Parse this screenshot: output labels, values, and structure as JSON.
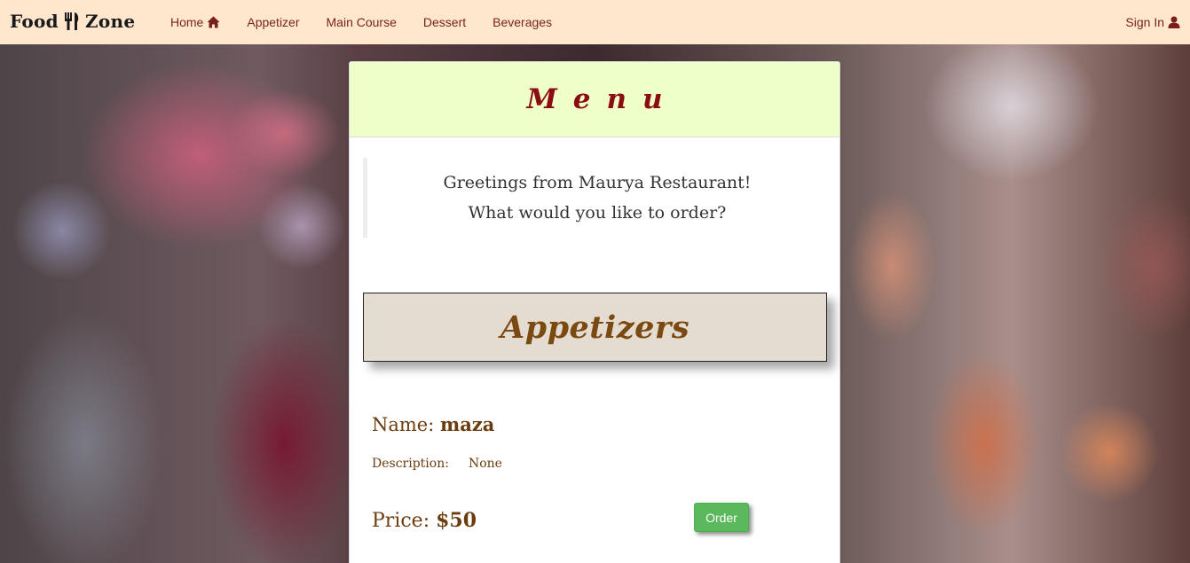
{
  "navbar": {
    "brand_left": "Food",
    "brand_right": "Zone",
    "brand_icon": "fork-knife-icon",
    "links": [
      {
        "label": "Home",
        "icon": "home-icon"
      },
      {
        "label": "Appetizer"
      },
      {
        "label": "Main Course"
      },
      {
        "label": "Dessert"
      },
      {
        "label": "Beverages"
      }
    ],
    "sign_in": {
      "label": "Sign In",
      "icon": "user-icon"
    }
  },
  "menu": {
    "title": "Menu",
    "greeting_line1": "Greetings from Maurya Restaurant!",
    "greeting_line2": "What would you like to order?",
    "section_title": "Appetizers",
    "item": {
      "name_label": "Name:",
      "name_value": "maza",
      "description_label": "Description:",
      "description_value": "None",
      "price_label": "Price:",
      "price_value": "$50",
      "order_label": "Order"
    }
  },
  "colors": {
    "navbar_bg": "#ffe7ce",
    "nav_text": "#7a1f1f",
    "menu_header_bg": "#eeffc9",
    "menu_title": "#8b0d13",
    "section_bg": "#e4dcd0",
    "item_text": "#6b3c0e",
    "order_button": "#5cb85c"
  }
}
